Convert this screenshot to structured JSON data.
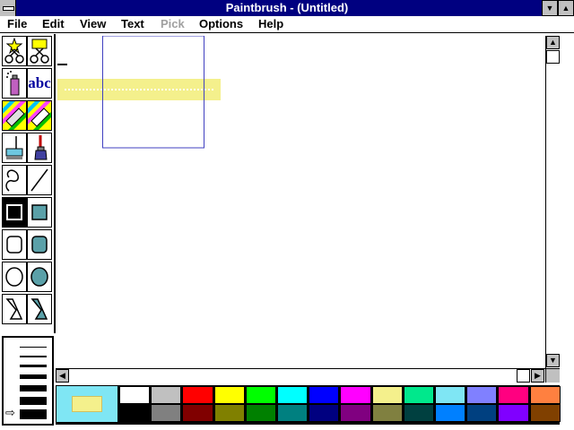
{
  "window": {
    "title": "Paintbrush - (Untitled)"
  },
  "menubar": {
    "items": [
      "File",
      "Edit",
      "View",
      "Text",
      "Pick",
      "Options",
      "Help"
    ],
    "disabled": [
      "Pick"
    ]
  },
  "tools": [
    {
      "name": "scissors-star-tool",
      "icon": "scissors-star-icon"
    },
    {
      "name": "scissors-rect-tool",
      "icon": "scissors-rect-icon"
    },
    {
      "name": "airbrush-tool",
      "icon": "airbrush-icon"
    },
    {
      "name": "text-tool",
      "icon": "text-icon"
    },
    {
      "name": "color-eraser-tool",
      "icon": "color-eraser-icon"
    },
    {
      "name": "eraser-tool",
      "icon": "eraser-icon"
    },
    {
      "name": "paint-roller-tool",
      "icon": "paint-roller-icon"
    },
    {
      "name": "brush-tool",
      "icon": "brush-icon"
    },
    {
      "name": "curve-tool",
      "icon": "curve-icon"
    },
    {
      "name": "line-tool",
      "icon": "line-icon"
    },
    {
      "name": "box-tool",
      "icon": "box-icon"
    },
    {
      "name": "filled-box-tool",
      "icon": "filled-box-icon"
    },
    {
      "name": "rounded-box-tool",
      "icon": "rounded-box-icon"
    },
    {
      "name": "filled-rounded-box-tool",
      "icon": "filled-rounded-box-icon"
    },
    {
      "name": "circle-tool",
      "icon": "circle-icon"
    },
    {
      "name": "filled-circle-tool",
      "icon": "filled-circle-icon"
    },
    {
      "name": "polygon-tool",
      "icon": "polygon-icon"
    },
    {
      "name": "filled-polygon-tool",
      "icon": "filled-polygon-icon"
    }
  ],
  "tool_text": {
    "text_tool_label": "abc"
  },
  "selected_tool": "box-tool",
  "colors": {
    "titlebar": "#000080",
    "current_background": "#7fe6f4",
    "current_foreground": "#f4f08c",
    "selection_band": "#f4f08c",
    "palette_top": [
      "#ffffff",
      "#c0c0c0",
      "#ff0000",
      "#ffff00",
      "#00ff00",
      "#00ffff",
      "#0000ff",
      "#ff00ff",
      "#f4f08c",
      "#00e88c",
      "#7fe6f4",
      "#8080ff",
      "#ff0080",
      "#ff8040"
    ],
    "palette_bottom": [
      "#000000",
      "#808080",
      "#800000",
      "#808000",
      "#008000",
      "#008080",
      "#000080",
      "#800080",
      "#808040",
      "#004040",
      "#0080ff",
      "#004080",
      "#8000ff",
      "#804000"
    ]
  },
  "icons": [
    "system-menu-icon",
    "minimize-icon",
    "maximize-icon",
    "scroll-up-icon",
    "scroll-down-icon",
    "scroll-left-icon",
    "scroll-right-icon",
    "linesize-pointer-icon"
  ]
}
